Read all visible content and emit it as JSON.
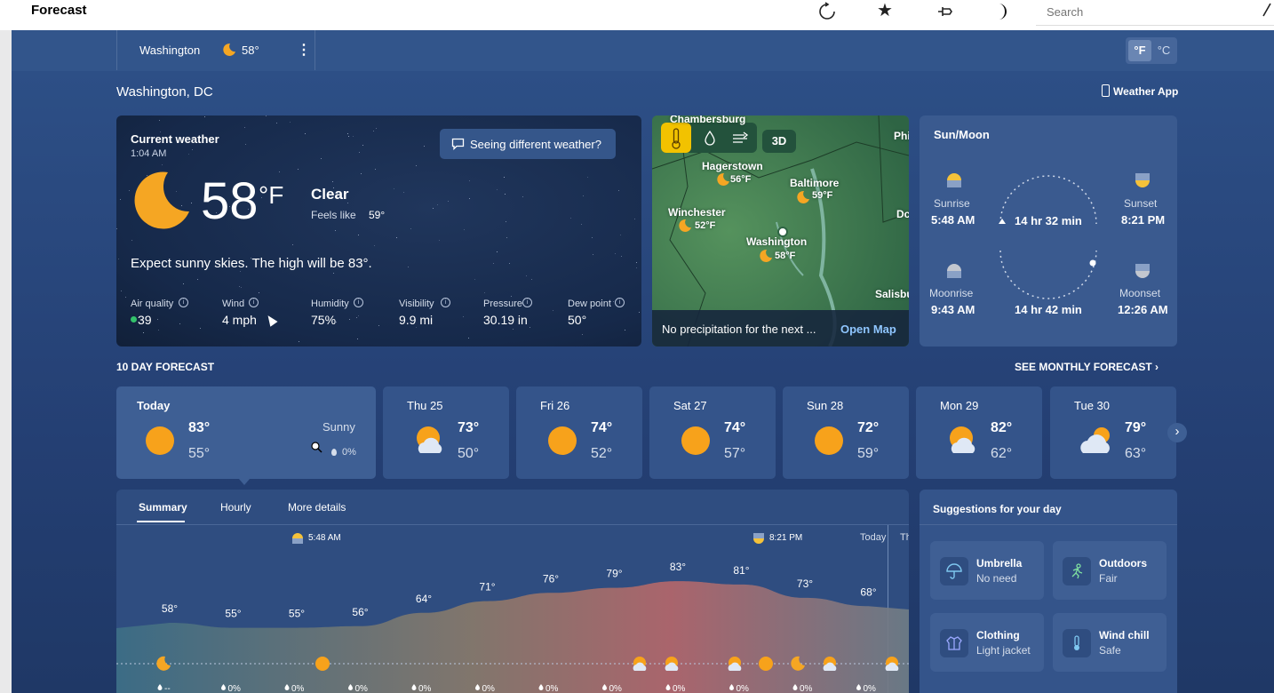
{
  "app": {
    "title": "Forecast"
  },
  "search": {
    "placeholder": "Search"
  },
  "nav": {
    "location": "Washington",
    "temp": "58°",
    "unit_f": "°F",
    "unit_c": "°C"
  },
  "header": {
    "city": "Washington, DC",
    "weather_app": "Weather App"
  },
  "current": {
    "heading": "Current weather",
    "time": "1:04 AM",
    "temp": "58",
    "unit": "°F",
    "condition": "Clear",
    "feels_label": "Feels like",
    "feels_value": "59°",
    "feedback": "Seeing different weather?",
    "summary": "Expect sunny skies. The high will be 83°.",
    "metrics": [
      {
        "label": "Air quality",
        "value": "39"
      },
      {
        "label": "Wind",
        "value": "4 mph"
      },
      {
        "label": "Humidity",
        "value": "75%"
      },
      {
        "label": "Visibility",
        "value": "9.9 mi"
      },
      {
        "label": "Pressure",
        "value": "30.19 in"
      },
      {
        "label": "Dew point",
        "value": "50°"
      }
    ]
  },
  "map": {
    "mode_3d": "3D",
    "cities": [
      {
        "name": "Chambersburg",
        "temp": ""
      },
      {
        "name": "Hagerstown",
        "temp": "56°F"
      },
      {
        "name": "Baltimore",
        "temp": "59°F"
      },
      {
        "name": "Winchester",
        "temp": "52°F"
      },
      {
        "name": "Washington",
        "temp": "58°F"
      },
      {
        "name": "Phi",
        "temp": ""
      },
      {
        "name": "Dc",
        "temp": ""
      },
      {
        "name": "Salisbu",
        "temp": ""
      }
    ],
    "footer_text": "No precipitation for the next ...",
    "open_map": "Open Map"
  },
  "sunmoon": {
    "title": "Sun/Moon",
    "sunrise_label": "Sunrise",
    "sunrise": "5:48 AM",
    "sunset_label": "Sunset",
    "sunset": "8:21 PM",
    "day_length": "14 hr 32 min",
    "moonrise_label": "Moonrise",
    "moonrise": "9:43 AM",
    "moonset_label": "Moonset",
    "moonset": "12:26 AM",
    "moon_length": "14 hr 42 min"
  },
  "forecast": {
    "heading": "10 DAY FORECAST",
    "monthly": "SEE MONTHLY FORECAST",
    "days": [
      {
        "day": "Today",
        "high": "83°",
        "low": "55°",
        "cond": "Sunny",
        "precip": "0%",
        "icon": "sun-icon"
      },
      {
        "day": "Thu 25",
        "high": "73°",
        "low": "50°",
        "icon": "partly-cloudy-icon"
      },
      {
        "day": "Fri 26",
        "high": "74°",
        "low": "52°",
        "icon": "sun-icon"
      },
      {
        "day": "Sat 27",
        "high": "74°",
        "low": "57°",
        "icon": "sun-icon"
      },
      {
        "day": "Sun 28",
        "high": "72°",
        "low": "59°",
        "icon": "sun-icon"
      },
      {
        "day": "Mon 29",
        "high": "82°",
        "low": "62°",
        "icon": "partly-cloudy-icon"
      },
      {
        "day": "Tue 30",
        "high": "79°",
        "low": "63°",
        "icon": "cloudy-icon"
      }
    ]
  },
  "tabs": {
    "summary": "Summary",
    "hourly": "Hourly",
    "more": "More details"
  },
  "chart_labels": {
    "sunrise": "5:48 AM",
    "sunset": "8:21 PM",
    "today": "Today",
    "next": "Th"
  },
  "chart_data": {
    "type": "area",
    "x": [
      "1",
      "2",
      "3",
      "4",
      "5",
      "6",
      "7",
      "8",
      "9",
      "10",
      "11",
      "12"
    ],
    "values": [
      58,
      55,
      55,
      56,
      64,
      71,
      76,
      79,
      83,
      81,
      73,
      68
    ],
    "labels": [
      "58°",
      "55°",
      "55°",
      "56°",
      "64°",
      "71°",
      "76°",
      "79°",
      "83°",
      "81°",
      "73°",
      "68°"
    ],
    "precip": [
      "--",
      "0%",
      "0%",
      "0%",
      "0%",
      "0%",
      "0%",
      "0%",
      "0%",
      "0%",
      "0%",
      "0%"
    ]
  },
  "suggestions": {
    "title": "Suggestions for your day",
    "items": [
      {
        "title": "Umbrella",
        "sub": "No need",
        "icon": "umbrella-icon"
      },
      {
        "title": "Outdoors",
        "sub": "Fair",
        "icon": "running-icon"
      },
      {
        "title": "Clothing",
        "sub": "Light jacket",
        "icon": "jacket-icon"
      },
      {
        "title": "Wind chill",
        "sub": "Safe",
        "icon": "thermometer-icon"
      }
    ]
  }
}
